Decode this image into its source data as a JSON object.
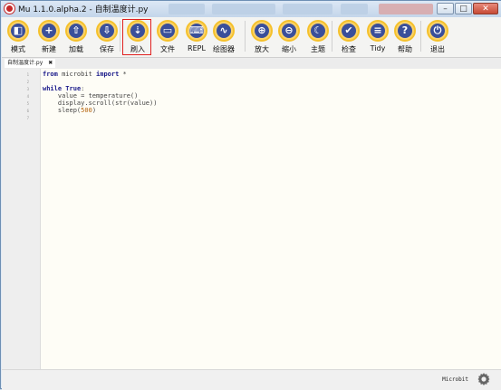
{
  "window": {
    "title": "Mu 1.1.0.alpha.2 - 自制温度计.py",
    "buttons": {
      "minimize": "–",
      "maximize": "□",
      "close": "✕"
    }
  },
  "toolbar": {
    "buttons": [
      {
        "key": "mode",
        "label": "模式",
        "icon": "mode-icon",
        "glyph": "◧"
      },
      {
        "key": "new",
        "label": "新建",
        "icon": "plus-icon",
        "glyph": "+"
      },
      {
        "key": "load",
        "label": "加载",
        "icon": "upload-icon",
        "glyph": "⇧"
      },
      {
        "key": "save",
        "label": "保存",
        "icon": "download-icon",
        "glyph": "⇩"
      },
      {
        "key": "flash",
        "label": "刷入",
        "icon": "flash-icon",
        "glyph": "⇣"
      },
      {
        "key": "files",
        "label": "文件",
        "icon": "files-icon",
        "glyph": "▭"
      },
      {
        "key": "repl",
        "label": "REPL",
        "icon": "keyboard-icon",
        "glyph": "⌨"
      },
      {
        "key": "plotter",
        "label": "绘图器",
        "icon": "pulse-icon",
        "glyph": "∿"
      },
      {
        "key": "zoom-in",
        "label": "放大",
        "icon": "zoom-in-icon",
        "glyph": "⊕"
      },
      {
        "key": "zoom-out",
        "label": "缩小",
        "icon": "zoom-out-icon",
        "glyph": "⊖"
      },
      {
        "key": "theme",
        "label": "主题",
        "icon": "moon-icon",
        "glyph": "☾"
      },
      {
        "key": "check",
        "label": "检查",
        "icon": "thumbs-up-icon",
        "glyph": "✔"
      },
      {
        "key": "tidy",
        "label": "Tidy",
        "icon": "list-icon",
        "glyph": "≡"
      },
      {
        "key": "help",
        "label": "帮助",
        "icon": "question-icon",
        "glyph": "?"
      },
      {
        "key": "quit",
        "label": "退出",
        "icon": "power-icon",
        "glyph": "⏻"
      }
    ],
    "highlighted": "flash"
  },
  "tabs": [
    {
      "label": "自制温度计.py",
      "close": "✖"
    }
  ],
  "editor": {
    "line_numbers": [
      "1",
      "2",
      "3",
      "4",
      "5",
      "6",
      "7"
    ],
    "lines": [
      [
        {
          "t": "from",
          "k": "kw"
        },
        {
          "t": " microbit ",
          "k": "fn"
        },
        {
          "t": "import",
          "k": "kw"
        },
        {
          "t": " *",
          "k": "fn"
        }
      ],
      [],
      [
        {
          "t": "while",
          "k": "kw"
        },
        {
          "t": " ",
          "k": "fn"
        },
        {
          "t": "True",
          "k": "kw"
        },
        {
          "t": ":",
          "k": "fn"
        }
      ],
      [
        {
          "t": "    value = temperature()",
          "k": "fn"
        }
      ],
      [
        {
          "t": "    display.scroll(str(value))",
          "k": "fn"
        }
      ],
      [
        {
          "t": "    sleep(",
          "k": "fn"
        },
        {
          "t": "500",
          "k": "num"
        },
        {
          "t": ")",
          "k": "fn"
        }
      ],
      []
    ]
  },
  "status": {
    "mode": "Microbit",
    "settings_icon": "gear-icon"
  }
}
